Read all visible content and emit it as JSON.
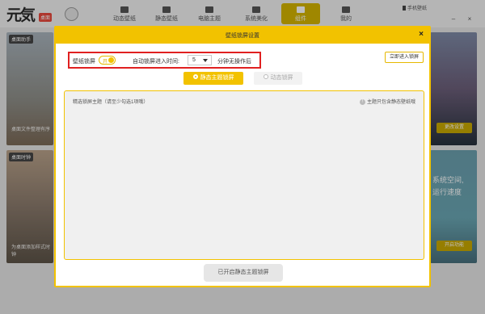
{
  "app": {
    "logo_text": "元気",
    "logo_tag": "桌面",
    "nav": [
      {
        "label": "动态壁纸",
        "icon": "video-icon"
      },
      {
        "label": "静态壁纸",
        "icon": "image-icon"
      },
      {
        "label": "电脑主题",
        "icon": "crown-icon"
      },
      {
        "label": "系统美化",
        "icon": "sparkle-icon"
      },
      {
        "label": "组件",
        "icon": "widget-icon",
        "active": true
      },
      {
        "label": "我的",
        "icon": "user-icon"
      }
    ],
    "phone_wallpaper": "手机壁纸",
    "window_controls": {
      "minimize": "–",
      "close": "×"
    }
  },
  "background": {
    "panel_left1_title": "桌面助手",
    "panel_left1_caption": "桌面文件整理有序",
    "panel_left2_title": "桌面时钟",
    "panel_left2_caption": "为桌面添加样式时钟",
    "panel_right1_button": "更改设置",
    "panel_right2_text": "系统空间,\n运行速度",
    "panel_right2_button": "开启功能"
  },
  "modal": {
    "title": "壁纸锁屏设置",
    "close": "×",
    "lock_label": "壁纸锁屏",
    "toggle_text": "开",
    "toggle_on": true,
    "auto_lock_label": "自动锁屏进入时间:",
    "auto_lock_value": "5",
    "after_label": "分钟无操作后",
    "lock_now_button": "立即进入锁屏",
    "tabs": [
      {
        "label": "静态主题锁屏",
        "selected": true
      },
      {
        "label": "动态锁屏",
        "selected": false
      }
    ],
    "theme_title": "精选锁屏主题（请至少勾选1项哦）",
    "theme_note": "主题只包含静态壁纸哦",
    "enable_button": "已开启静态主题锁屏"
  },
  "colors": {
    "accent": "#f2c200",
    "highlight_border": "#e02020"
  }
}
